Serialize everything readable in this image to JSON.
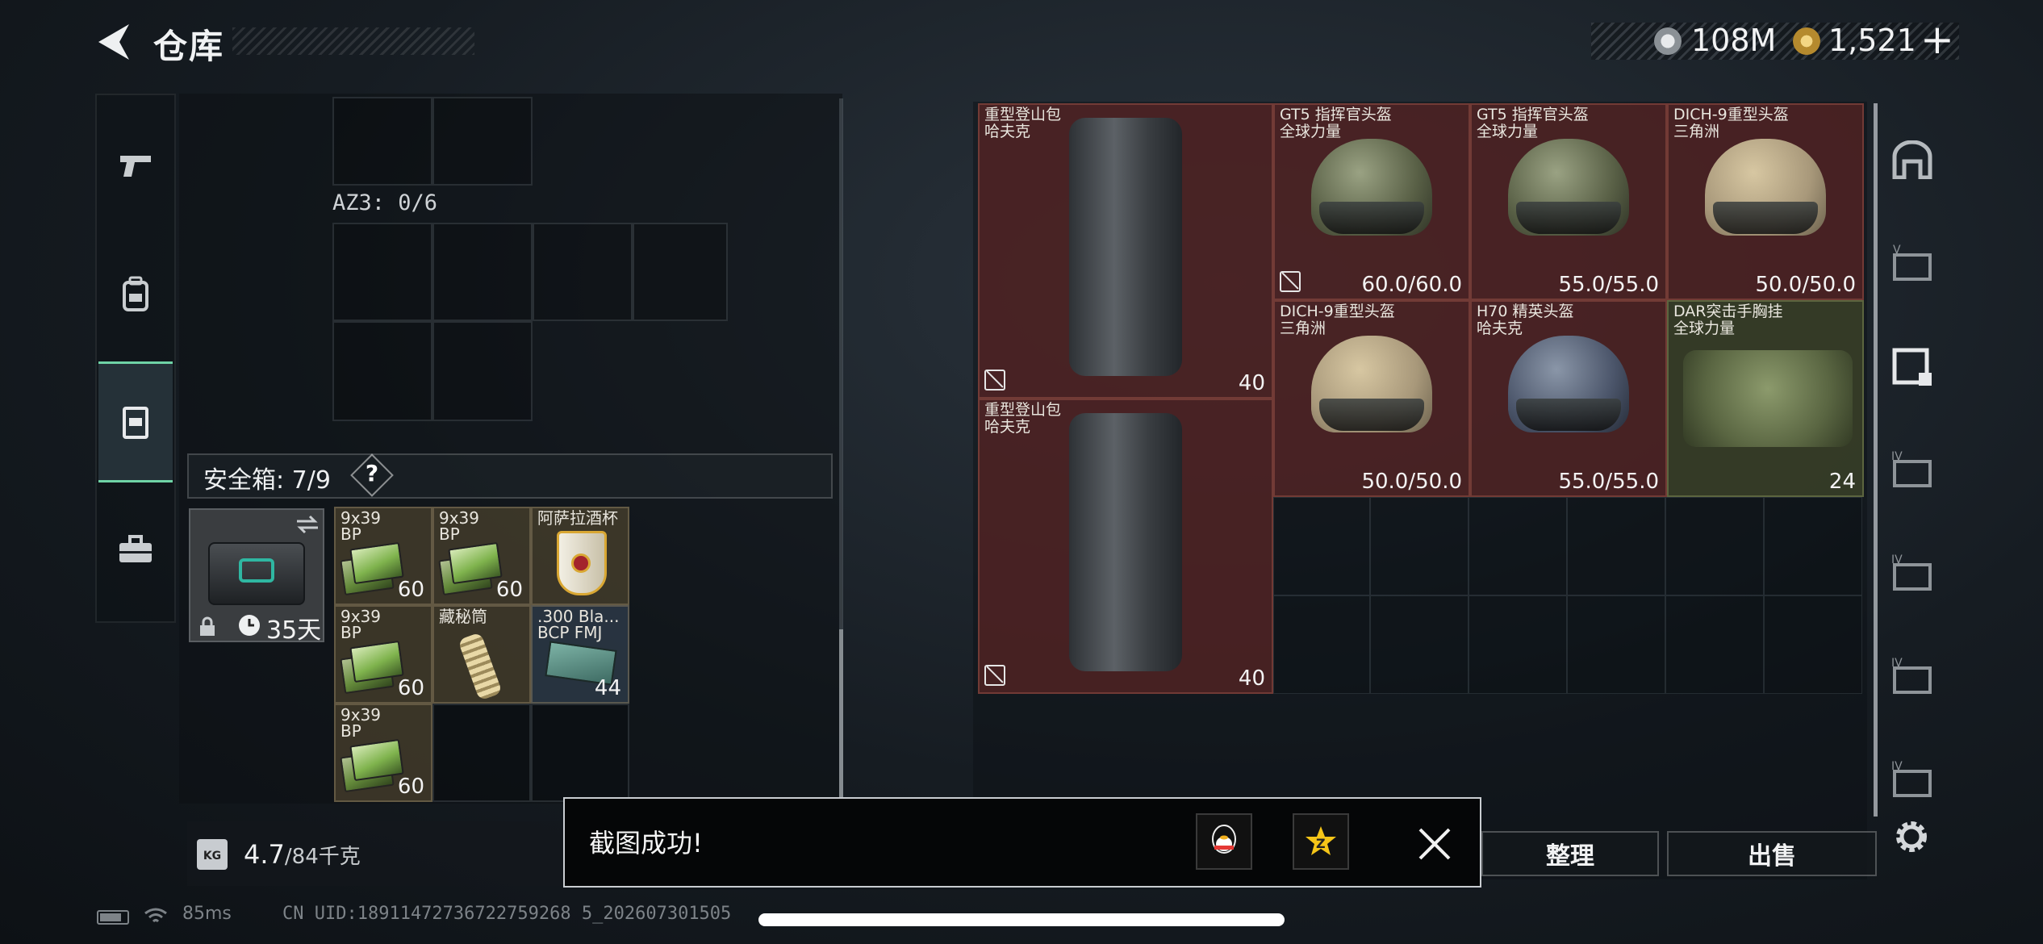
{
  "header": {
    "title": "仓库",
    "currency": [
      {
        "icon": "coin-silver-icon",
        "value": "108M"
      },
      {
        "icon": "coin-gold-icon",
        "value": "1,521"
      }
    ],
    "plus": "+"
  },
  "left_nav": [
    {
      "icon": "pistol-icon",
      "active": false
    },
    {
      "icon": "backpack-icon",
      "active": false
    },
    {
      "icon": "rig-icon",
      "active": true
    },
    {
      "icon": "briefcase-icon",
      "active": false
    }
  ],
  "stash": {
    "az3_label": "AZ3: 0/6",
    "safebox_label": "安全箱: 7/9",
    "safebox_help": "?",
    "safebox_days": "35天",
    "items": [
      {
        "name": "9x39\nBP",
        "count": "60",
        "kind": "ammo"
      },
      {
        "name": "9x39\nBP",
        "count": "60",
        "kind": "ammo"
      },
      {
        "name": "阿萨拉酒杯",
        "count": "",
        "kind": "cup"
      },
      {
        "name": "9x39\nBP",
        "count": "60",
        "kind": "ammo"
      },
      {
        "name": "藏秘筒",
        "count": "",
        "kind": "tube"
      },
      {
        "name": ".300 Bla...\nBCP FMJ",
        "count": "44",
        "kind": "ammo-dark"
      },
      {
        "name": "9x39\nBP",
        "count": "60",
        "kind": "ammo"
      }
    ],
    "weight_value": "4.7",
    "weight_max": "/84千克"
  },
  "inventory": [
    {
      "name": "重型登山包\n哈夫克",
      "count": "40",
      "kind": "backpack"
    },
    {
      "name": "GT5 指挥官头盔\n全球力量",
      "count": "60.0/60.0",
      "kind": "helmet-green"
    },
    {
      "name": "GT5 指挥官头盔\n全球力量",
      "count": "55.0/55.0",
      "kind": "helmet-green"
    },
    {
      "name": "DICH-9重型头盔\n三角洲",
      "count": "50.0/50.0",
      "kind": "helmet-tan"
    },
    {
      "name": "DICH-9重型头盔\n三角洲",
      "count": "50.0/50.0",
      "kind": "helmet-tan"
    },
    {
      "name": "H70 精英头盔\n哈夫克",
      "count": "55.0/55.0",
      "kind": "helmet-navy"
    },
    {
      "name": "DAR突击手胸挂\n全球力量",
      "count": "24",
      "kind": "rig"
    },
    {
      "name": "重型登山包\n哈夫克",
      "count": "40",
      "kind": "backpack"
    }
  ],
  "right_tabs": [
    "home-tab-icon",
    "storage-v-icon",
    "storage-locked-icon",
    "storage-iv-a-icon",
    "storage-iv-b-icon",
    "storage-iv-c-icon",
    "storage-iv-d-icon"
  ],
  "buttons": {
    "sort": "整理",
    "sell": "出售"
  },
  "toast": {
    "text": "截图成功!"
  },
  "status": {
    "ping": "85ms",
    "uid": "CN UID:18911472736722759268 5_202607301505"
  }
}
